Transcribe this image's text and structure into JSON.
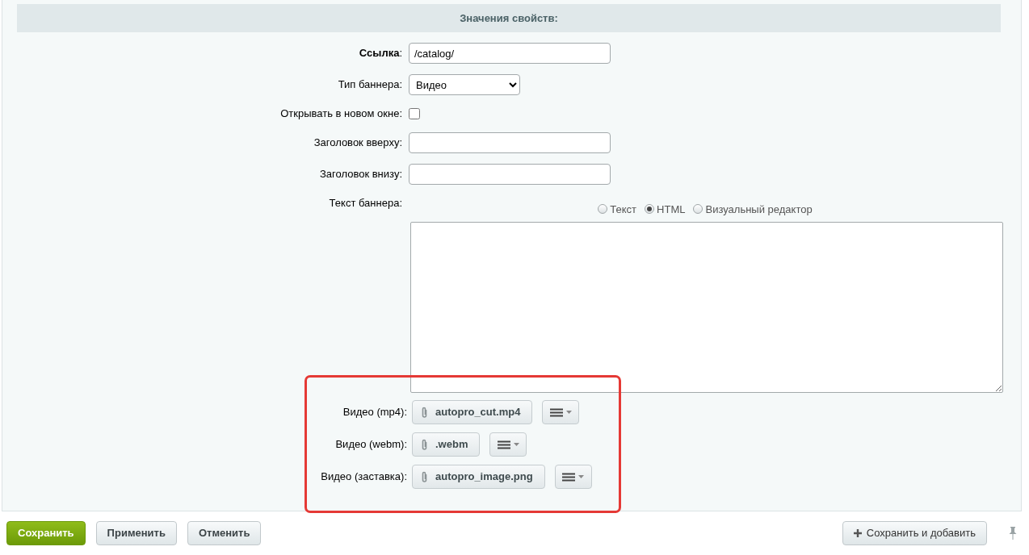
{
  "section_title": "Значения свойств:",
  "fields": [
    {
      "kind": "text",
      "label": "**Ссылка**:",
      "value": "/catalog/"
    },
    {
      "kind": "select",
      "label": "Тип баннера:",
      "value": "Видео"
    },
    {
      "kind": "checkbox",
      "label": "Открывать в новом окне:",
      "checked": false
    },
    {
      "kind": "text",
      "label": "Заголовок вверху:"
    },
    {
      "kind": "text",
      "label": "Заголовок внизу:"
    },
    {
      "kind": "editor",
      "label": "Текст баннера:",
      "modes": [
        {
          "label": "Текст",
          "selected": false
        },
        {
          "label": "HTML",
          "selected": true
        },
        {
          "label": "Визуальный редактор",
          "selected": false
        }
      ]
    }
  ],
  "highlighted_files": [
    {
      "label": "Видео (mp4):",
      "file": "autopro_cut.mp4"
    },
    {
      "label": "Видео (webm):",
      "file": ".webm"
    },
    {
      "label": "Видео (заставка):",
      "file": "autopro_image.png"
    }
  ],
  "footer": {
    "buttons": [
      {
        "label": "Сохранить",
        "kind": "primary"
      },
      {
        "label": "Применить",
        "kind": "default"
      },
      {
        "label": "Отменить",
        "kind": "default"
      }
    ],
    "right_button": {
      "label": "Сохранить и добавить"
    }
  }
}
